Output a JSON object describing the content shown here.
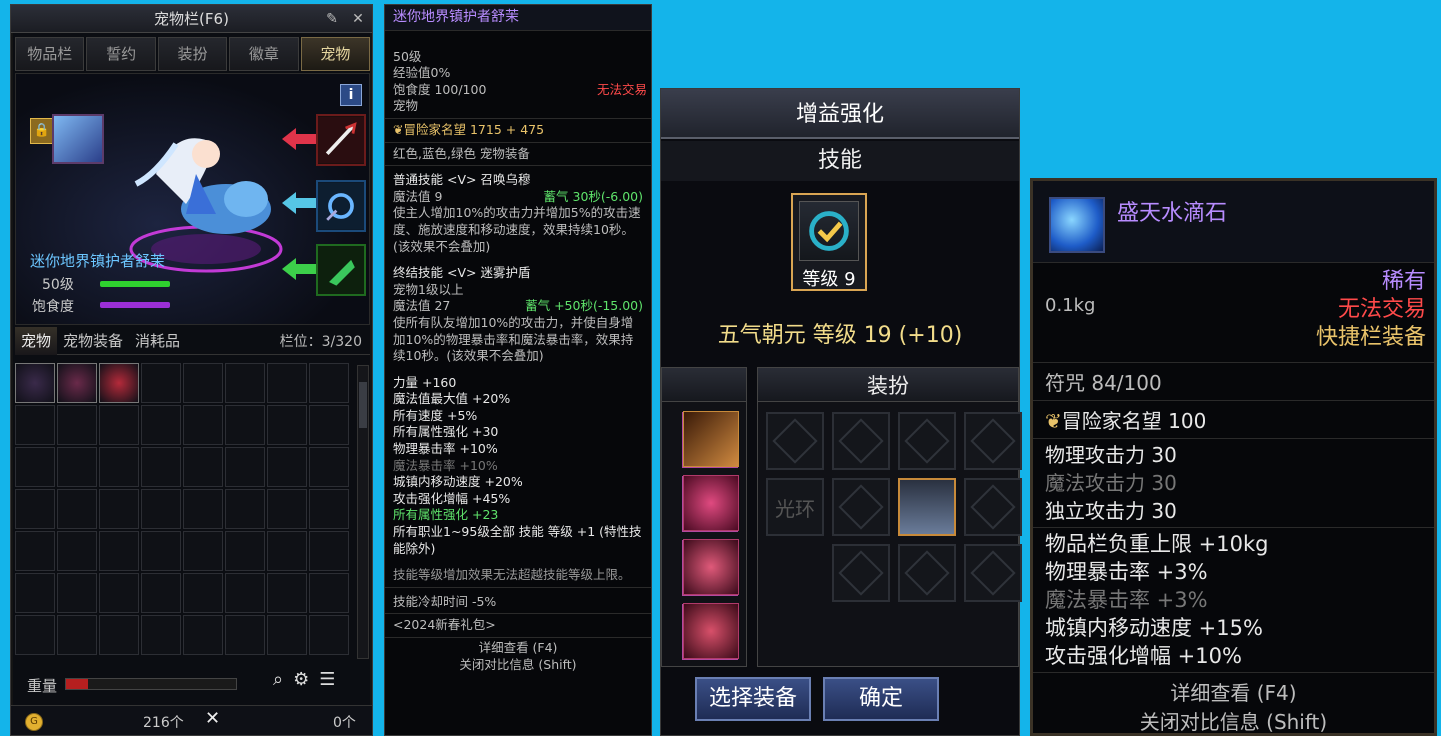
{
  "inventory": {
    "title": "宠物栏(F6)",
    "tabs": [
      "物品栏",
      "誓约",
      "装扮",
      "徽章",
      "宠物"
    ],
    "active_tab_index": 4,
    "pet_name": "迷你地界镇护者舒茉",
    "level_text": "50级",
    "fullness_label": "饱食度",
    "subtabs": [
      "宠物",
      "宠物装备",
      "消耗品"
    ],
    "slot_count": "栏位：3/320",
    "weight_label": "重量",
    "gold": "216个",
    "other_count": "0个",
    "colors": {
      "level_bar": "#2fd12f",
      "fullness_bar": "#9b2fd6",
      "accent": "#e6d7a0"
    }
  },
  "tooltip": {
    "name": "迷你地界镇护者舒茉",
    "level": "50级",
    "exp": "经验值0%",
    "fullness": "饱食度 100/100",
    "trade": "无法交易",
    "type": "宠物",
    "fame": "冒险家名望 1715 + 475",
    "equip_colors": "红色,蓝色,绿色 宠物装备",
    "normal_skill_title": "普通技能 <V> 召唤乌穆",
    "normal_mp": "魔法值 9",
    "normal_charge": "蓄气 30秒(-6.00)",
    "normal_desc": "使主人增加10%的攻击力并增加5%的攻击速度、施放速度和移动速度，效果持续10秒。(该效果不会叠加)",
    "final_skill_title": "终结技能 <V> 迷雾护盾",
    "final_req": "宠物1级以上",
    "final_mp": "魔法值 27",
    "final_charge": "蓄气 +50秒(-15.00)",
    "final_desc": "使所有队友增加10%的攻击力，并使自身增加10%的物理暴击率和魔法暴击率，效果持续10秒。(该效果不会叠加)",
    "stats": [
      {
        "text": "力量 +160",
        "style": "white"
      },
      {
        "text": "魔法值最大值 +20%",
        "style": "white"
      },
      {
        "text": "所有速度 +5%",
        "style": "white"
      },
      {
        "text": "所有属性强化 +30",
        "style": "white"
      },
      {
        "text": "物理暴击率 +10%",
        "style": "white"
      },
      {
        "text": "魔法暴击率 +10%",
        "style": "gray"
      },
      {
        "text": "城镇内移动速度 +20%",
        "style": "white"
      },
      {
        "text": "攻击强化增幅 +45%",
        "style": "white"
      },
      {
        "text": "所有属性强化 +23",
        "style": "green"
      },
      {
        "text": "所有职业1~95级全部 技能 等级 +1 (特性技能除外)",
        "style": "white"
      }
    ],
    "skill_note": "技能等级增加效果无法超越技能等级上限。",
    "cooldown": "技能冷却时间 -5%",
    "source": "<2024新春礼包>",
    "detail": "详细查看 (F4)",
    "close_compare": "关闭对比信息 (Shift)"
  },
  "buff": {
    "title": "增益强化",
    "skill_label": "技能",
    "skill_level": "等级 9",
    "skill_name_line": "五气朝元 等级 19 (+10)",
    "equip_pane": "装扮",
    "aura": "光环",
    "select_button": "选择装备",
    "confirm_button": "确定"
  },
  "item": {
    "name": "盛天水滴石",
    "rarity": "稀有",
    "weight": "0.1kg",
    "trade": "无法交易",
    "equip_type": "快捷栏装备",
    "charm": "符咒 84/100",
    "fame": "冒险家名望 100",
    "attacks": [
      {
        "text": "物理攻击力 30",
        "style": "white"
      },
      {
        "text": "魔法攻击力 30",
        "style": "gray"
      },
      {
        "text": "独立攻击力 30",
        "style": "white"
      }
    ],
    "effects": [
      {
        "text": "物品栏负重上限 +10kg",
        "style": "white"
      },
      {
        "text": "物理暴击率 +3%",
        "style": "white"
      },
      {
        "text": "魔法暴击率 +3%",
        "style": "gray"
      },
      {
        "text": "城镇内移动速度 +15%",
        "style": "white"
      },
      {
        "text": "攻击强化增幅 +10%",
        "style": "white"
      }
    ],
    "detail": "详细查看 (F4)",
    "close_compare": "关闭对比信息 (Shift)",
    "colors": {
      "name": "#b88cff",
      "rarity": "#b88cff",
      "trade": "#ff4a4a",
      "equip": "#e9c36a"
    }
  }
}
